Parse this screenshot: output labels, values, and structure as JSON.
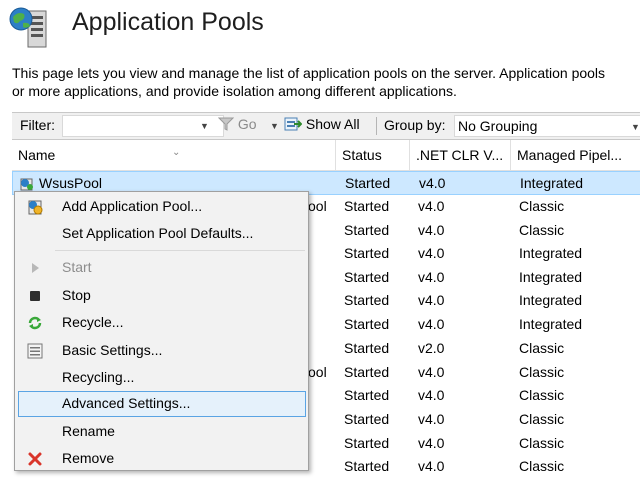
{
  "page": {
    "title": "Application Pools",
    "description_line1": "This page lets you view and manage the list of application pools on the server. Application pools",
    "description_line2": "or more applications, and provide isolation among different applications."
  },
  "toolbar": {
    "filter_label": "Filter:",
    "go_label": "Go",
    "show_all_label": "Show All",
    "group_by_label": "Group by:",
    "group_by_value": "No Grouping"
  },
  "grid": {
    "columns": [
      "Name",
      "Status",
      ".NET CLR V...",
      "Managed Pipel..."
    ],
    "rows": [
      {
        "name": "WsusPool",
        "status": "Started",
        "clr": "v4.0",
        "pipeline": "Integrated"
      },
      {
        "name": "ool",
        "status": "Started",
        "clr": "v4.0",
        "pipeline": "Classic"
      },
      {
        "name": "",
        "status": "Started",
        "clr": "v4.0",
        "pipeline": "Classic"
      },
      {
        "name": "",
        "status": "Started",
        "clr": "v4.0",
        "pipeline": "Integrated"
      },
      {
        "name": "",
        "status": "Started",
        "clr": "v4.0",
        "pipeline": "Integrated"
      },
      {
        "name": "",
        "status": "Started",
        "clr": "v4.0",
        "pipeline": "Integrated"
      },
      {
        "name": "",
        "status": "Started",
        "clr": "v4.0",
        "pipeline": "Integrated"
      },
      {
        "name": "",
        "status": "Started",
        "clr": "v2.0",
        "pipeline": "Classic"
      },
      {
        "name": "ool",
        "status": "Started",
        "clr": "v4.0",
        "pipeline": "Classic"
      },
      {
        "name": "",
        "status": "Started",
        "clr": "v4.0",
        "pipeline": "Classic"
      },
      {
        "name": "",
        "status": "Started",
        "clr": "v4.0",
        "pipeline": "Classic"
      },
      {
        "name": "",
        "status": "Started",
        "clr": "v4.0",
        "pipeline": "Classic"
      },
      {
        "name": "",
        "status": "Started",
        "clr": "v4.0",
        "pipeline": "Classic"
      }
    ]
  },
  "context_menu": {
    "items": [
      {
        "label": "Add Application Pool...",
        "icon": "add-pool-icon"
      },
      {
        "label": "Set Application Pool Defaults..."
      },
      {
        "label": "Start",
        "icon": "play-icon"
      },
      {
        "label": "Stop",
        "icon": "stop-icon"
      },
      {
        "label": "Recycle...",
        "icon": "recycle-icon"
      },
      {
        "label": "Basic Settings...",
        "icon": "settings-icon"
      },
      {
        "label": "Recycling..."
      },
      {
        "label": "Advanced Settings..."
      },
      {
        "label": "Rename"
      },
      {
        "label": "Remove",
        "icon": "remove-x-icon"
      }
    ]
  },
  "colors": {
    "selection": "#cde8ff",
    "menu_highlight": "#e5f1fb",
    "remove_red": "#d9352a",
    "recycle_green": "#3aa83a"
  }
}
